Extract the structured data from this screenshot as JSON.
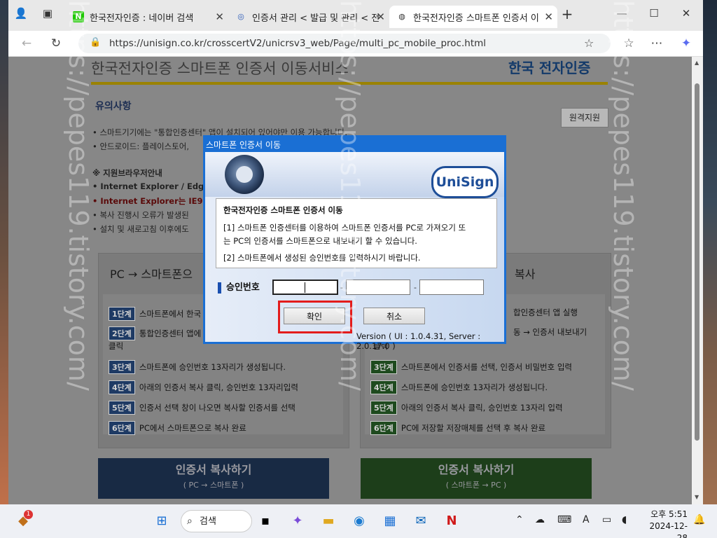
{
  "browser": {
    "tabs": [
      {
        "label": "한국전자인증 : 네이버 검색",
        "favicon": "N"
      },
      {
        "label": "인증서 관리 < 발급 및 관리 < 전",
        "favicon": "G"
      },
      {
        "label": "한국전자인증 스마트폰 인증서 이",
        "favicon": "globe"
      }
    ],
    "url": "https://unisign.co.kr/crosscertV2/unicrsv3_web/Page/multi_pc_mobile_proc.html"
  },
  "page": {
    "title": "한국전자인증 스마트폰 인증서 이동서비스",
    "logo": "한국 전자인증",
    "notice_heading": "유의사항",
    "remote_button": "원격지원",
    "notices": [
      "• 스마트기기에는 \"통합인증센터\" 앱이 설치되어 있어야만 이용 가능합니다.",
      "• 안드로이드: 플레이스토어,",
      "※ 지원브라우저안내",
      "• Internet Explorer / Edg",
      "• Internet Explorer는 IE9",
      "• 복사 진행시 오류가 발생된",
      "• 설치 및 새로고침 이후에도"
    ],
    "left_panel": {
      "heading": "PC → 스마트폰으",
      "steps": [
        {
          "badge": "1단계",
          "text": "스마트폰에서 한국"
        },
        {
          "badge": "2단계",
          "text": "통합인증센터 앱에"
        },
        {
          "badge": "",
          "text": "클릭"
        },
        {
          "badge": "3단계",
          "text": "스마트폰에 승인번호 13자리가 생성됩니다."
        },
        {
          "badge": "4단계",
          "text": "아래의 인증서 복사 클릭, 승인번호 13자리입력"
        },
        {
          "badge": "5단계",
          "text": "인증서 선택 창이 나오면 복사할 인증서를 선택"
        },
        {
          "badge": "6단계",
          "text": "PC에서 스마트폰으로 복사 완료"
        }
      ],
      "button_title": "인증서 복사하기",
      "button_sub": "( PC → 스마트폰 )"
    },
    "right_panel": {
      "heading": "복사",
      "steps": [
        {
          "badge": "",
          "text": "합인증센터 앱 실행"
        },
        {
          "badge": "",
          "text": "동 → 인증서 내보내기"
        },
        {
          "badge": "",
          "text": "클릭"
        },
        {
          "badge": "3단계",
          "text": "스마트폰에서 인증서를 선택, 인증서 비밀번호 입력"
        },
        {
          "badge": "4단계",
          "text": "스마트폰에 승인번호 13자리가 생성됩니다."
        },
        {
          "badge": "5단계",
          "text": "아래의 인증서 복사 클릭, 승인번호 13자리 입력"
        },
        {
          "badge": "6단계",
          "text": "PC에 저장할 저장매체를 선택 후 복사 완료"
        }
      ],
      "button_title": "인증서 복사하기",
      "button_sub": "( 스마트폰 → PC )"
    }
  },
  "dialog": {
    "title": "스마트폰 인증서 이동",
    "brand": "UniSign",
    "info_title": "한국전자인증 스마트폰 인증서 이동",
    "info_line1": "[1] 스마트폰 인증센터를 이용하여 스마트폰 인증서를 PC로 가져오기 또",
    "info_line2": "는 PC의 인증서를 스마트폰으로 내보내기 할 수 있습니다.",
    "info_line3": "[2] 스마트폰에서 생성된 승인번호를 입력하시기 바랍니다.",
    "code_label": "승인번호",
    "confirm": "확인",
    "cancel": "취소",
    "version": "Version ( UI : 1.0.4.31, Server : 2.0.17.0 )"
  },
  "watermark": "https://pepes119.tistory.com/",
  "taskbar": {
    "search": "검색",
    "badge": "1",
    "ime": "A",
    "time": "오후 5:51",
    "date": "2024-12-28"
  }
}
